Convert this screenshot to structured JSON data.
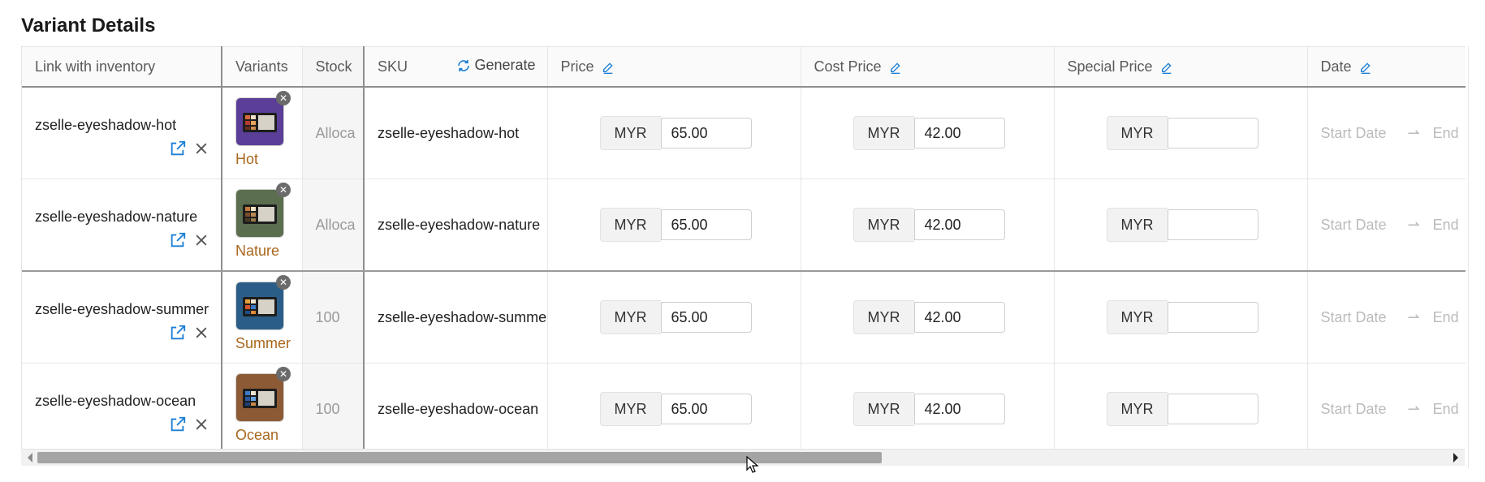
{
  "title": "Variant Details",
  "columns": {
    "link": "Link with inventory",
    "variants": "Variants",
    "stock": "Stock",
    "sku": "SKU",
    "generate": "Generate",
    "price": "Price",
    "cost_price": "Cost Price",
    "special_price": "Special Price",
    "date": "Date"
  },
  "rows": [
    {
      "link": "zselle-eyeshadow-hot",
      "variant": "Hot",
      "stock": "Alloca",
      "sku": "zselle-eyeshadow-hot",
      "currency": "MYR",
      "price": "65.00",
      "cost_price": "42.00",
      "special_price": "",
      "start_date": "Start Date",
      "end_date": "End",
      "swatch_color": "#5a3e98"
    },
    {
      "link": "zselle-eyeshadow-nature",
      "variant": "Nature",
      "stock": "Alloca",
      "sku": "zselle-eyeshadow-nature",
      "currency": "MYR",
      "price": "65.00",
      "cost_price": "42.00",
      "special_price": "",
      "start_date": "Start Date",
      "end_date": "End",
      "swatch_color": "#5b6e4f"
    },
    {
      "link": "zselle-eyeshadow-summer",
      "variant": "Summer",
      "stock": "100",
      "sku": "zselle-eyeshadow-summe",
      "currency": "MYR",
      "price": "65.00",
      "cost_price": "42.00",
      "special_price": "",
      "start_date": "Start Date",
      "end_date": "End",
      "swatch_color": "#2a5e88"
    },
    {
      "link": "zselle-eyeshadow-ocean",
      "variant": "Ocean",
      "stock": "100",
      "sku": "zselle-eyeshadow-ocean",
      "currency": "MYR",
      "price": "65.00",
      "cost_price": "42.00",
      "special_price": "",
      "start_date": "Start Date",
      "end_date": "End",
      "swatch_color": "#8c5a34"
    }
  ],
  "icons": {
    "edit": "pencil-icon",
    "generate": "refresh-icon",
    "open": "external-link-icon",
    "remove": "close-icon"
  },
  "colors": {
    "accent": "#1a7fd4",
    "variant_label": "#a9661c"
  }
}
